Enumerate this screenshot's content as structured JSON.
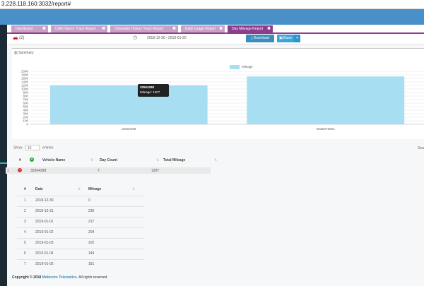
{
  "browser": {
    "url": "3.228.118.160:3032/report#"
  },
  "tabs": [
    {
      "label": "Dashboard"
    },
    {
      "label": "CAN History Track Report"
    },
    {
      "label": "Odometer History Track Report"
    },
    {
      "label": "Daily Usage Report"
    },
    {
      "label": "Day Mileage Report"
    }
  ],
  "tab_close_glyph": "✖",
  "filters": {
    "vehicle_count": "(2)",
    "date_range": "2018-12-30 - 2019-01-20",
    "download_label": "Download",
    "share_label": "Share",
    "caret": "▾"
  },
  "summary": {
    "title": "Summary",
    "tooltip_title": "32504398",
    "tooltip_value": "Mileage: 1207"
  },
  "chart_data": {
    "type": "bar",
    "categories": [
      "32504398",
      "663B3T6554"
    ],
    "series": [
      {
        "name": "Mileage",
        "values": [
          1207,
          1710
        ],
        "color": "#a8def2"
      }
    ],
    "yticks": [
      0,
      100,
      200,
      300,
      400,
      500,
      600,
      700,
      800,
      900,
      1000,
      1200,
      1400,
      1600,
      1800,
      2000
    ],
    "ylim": [
      0,
      2000
    ]
  },
  "table": {
    "show_label": "Show",
    "entries_value": "10",
    "entries_label": "entries",
    "search_label": "Sea",
    "headers": {
      "num": "#",
      "vehicle": "Vehicle Name",
      "day_count": "Day Count",
      "total": "Total Mileage"
    },
    "rows": [
      {
        "num": "1",
        "vehicle": "32504398",
        "day_count": "7",
        "total": "1207"
      }
    ]
  },
  "day_table": {
    "headers": {
      "num": "#",
      "date": "Date",
      "mileage": "Mileage"
    },
    "rows": [
      {
        "num": "1",
        "date": "2018-12-30",
        "mileage": "0"
      },
      {
        "num": "2",
        "date": "2018-12-31",
        "mileage": "230"
      },
      {
        "num": "3",
        "date": "2019-01-01",
        "mileage": "217"
      },
      {
        "num": "4",
        "date": "2019-01-02",
        "mileage": "204"
      },
      {
        "num": "5",
        "date": "2019-01-03",
        "mileage": "202"
      },
      {
        "num": "6",
        "date": "2019-01-04",
        "mileage": "144"
      },
      {
        "num": "7",
        "date": "2019-01-05",
        "mileage": "181"
      }
    ]
  },
  "footer": {
    "prefix": "Copyright © 2018",
    "company": "Mobicore Telematics.",
    "suffix": "All rights reserved."
  }
}
